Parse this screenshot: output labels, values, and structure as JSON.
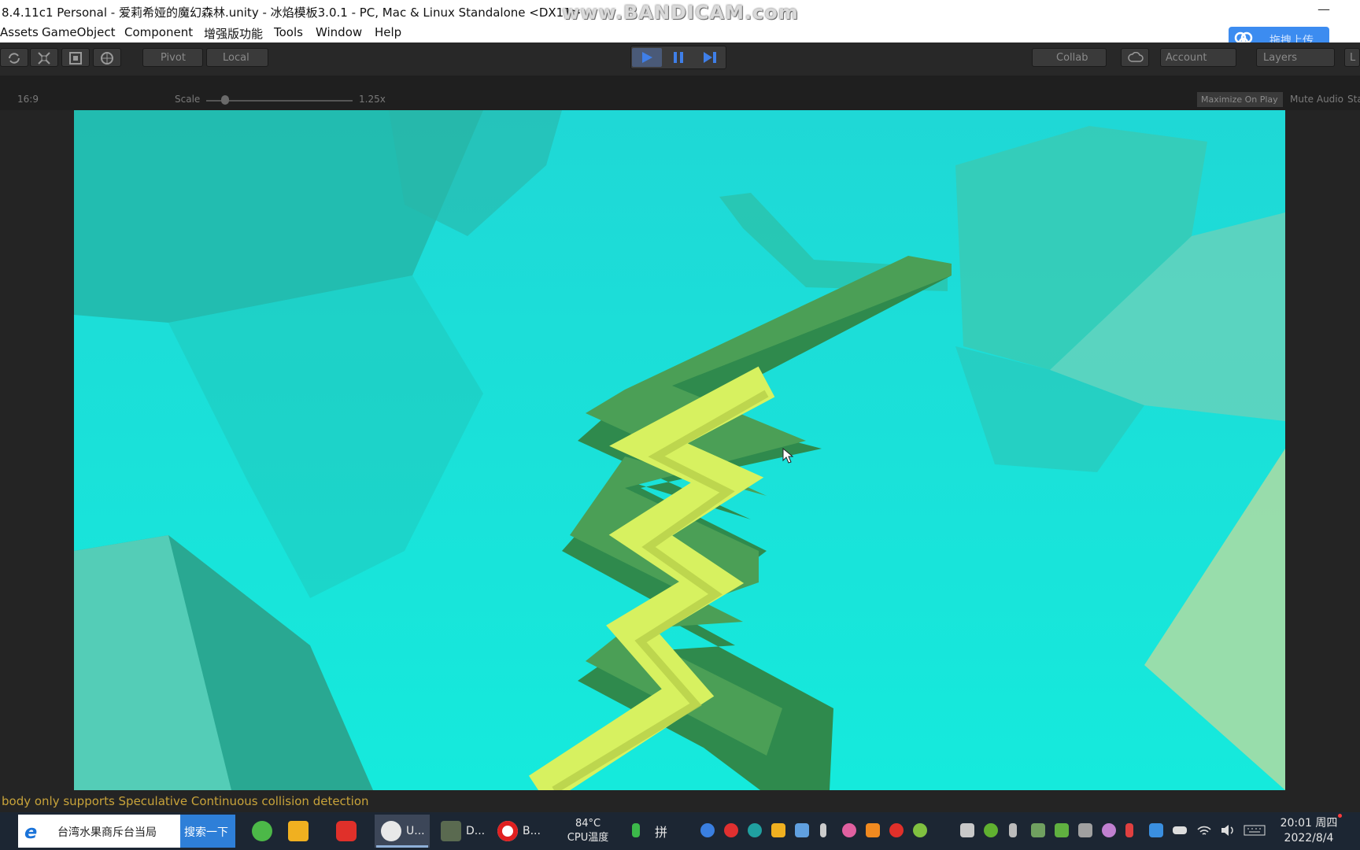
{
  "window": {
    "title": "8.4.11c1 Personal - 爱莉希娅的魔幻森林.unity - 冰焰模板3.0.1 - PC, Mac & Linux Standalone <DX11>",
    "watermark": "www.BANDICAM.com",
    "minimize_glyph": "—"
  },
  "menu": {
    "items": [
      "Assets",
      "GameObject",
      "Component",
      "增强版功能",
      "Tools",
      "Window",
      "Help"
    ]
  },
  "upload_button": {
    "label": "拖拽上传",
    "icon": "cloud-icon"
  },
  "toolbar": {
    "pivot_label": "Pivot",
    "local_label": "Local",
    "collab_label": "Collab",
    "account_label": "Account",
    "layers_label": "Layers",
    "layout_label": "L",
    "tools": [
      "rotate-tool-icon",
      "scale-tool-icon",
      "rect-tool-icon",
      "transform-tool-icon"
    ],
    "play_active": true
  },
  "game_view": {
    "aspect": "16:9",
    "scale_label": "Scale",
    "scale_value": "1.25x",
    "scale_fraction": 0.1,
    "maximize_on_play": "Maximize On Play",
    "mute_audio": "Mute Audio",
    "stats": "Sta"
  },
  "scene": {
    "sky_color": "#18e6dc",
    "path_color": "#4a9a4a",
    "trail_color": "#d8f060"
  },
  "console": {
    "message": "body only supports Speculative Continuous collision detection"
  },
  "taskbar": {
    "search_text": "台湾水果商斥台当局",
    "search_button": "搜索一下",
    "apps": [
      {
        "label": "U...",
        "icon": "unity-icon",
        "active": true
      },
      {
        "label": "D...",
        "icon": "game-icon",
        "active": false
      },
      {
        "label": "B...",
        "icon": "bandicam-icon",
        "active": false
      }
    ],
    "temperature": "84°C",
    "temperature_label": "CPU温度",
    "ime": "拼",
    "time": "20:01 周四",
    "date": "2022/8/4"
  }
}
